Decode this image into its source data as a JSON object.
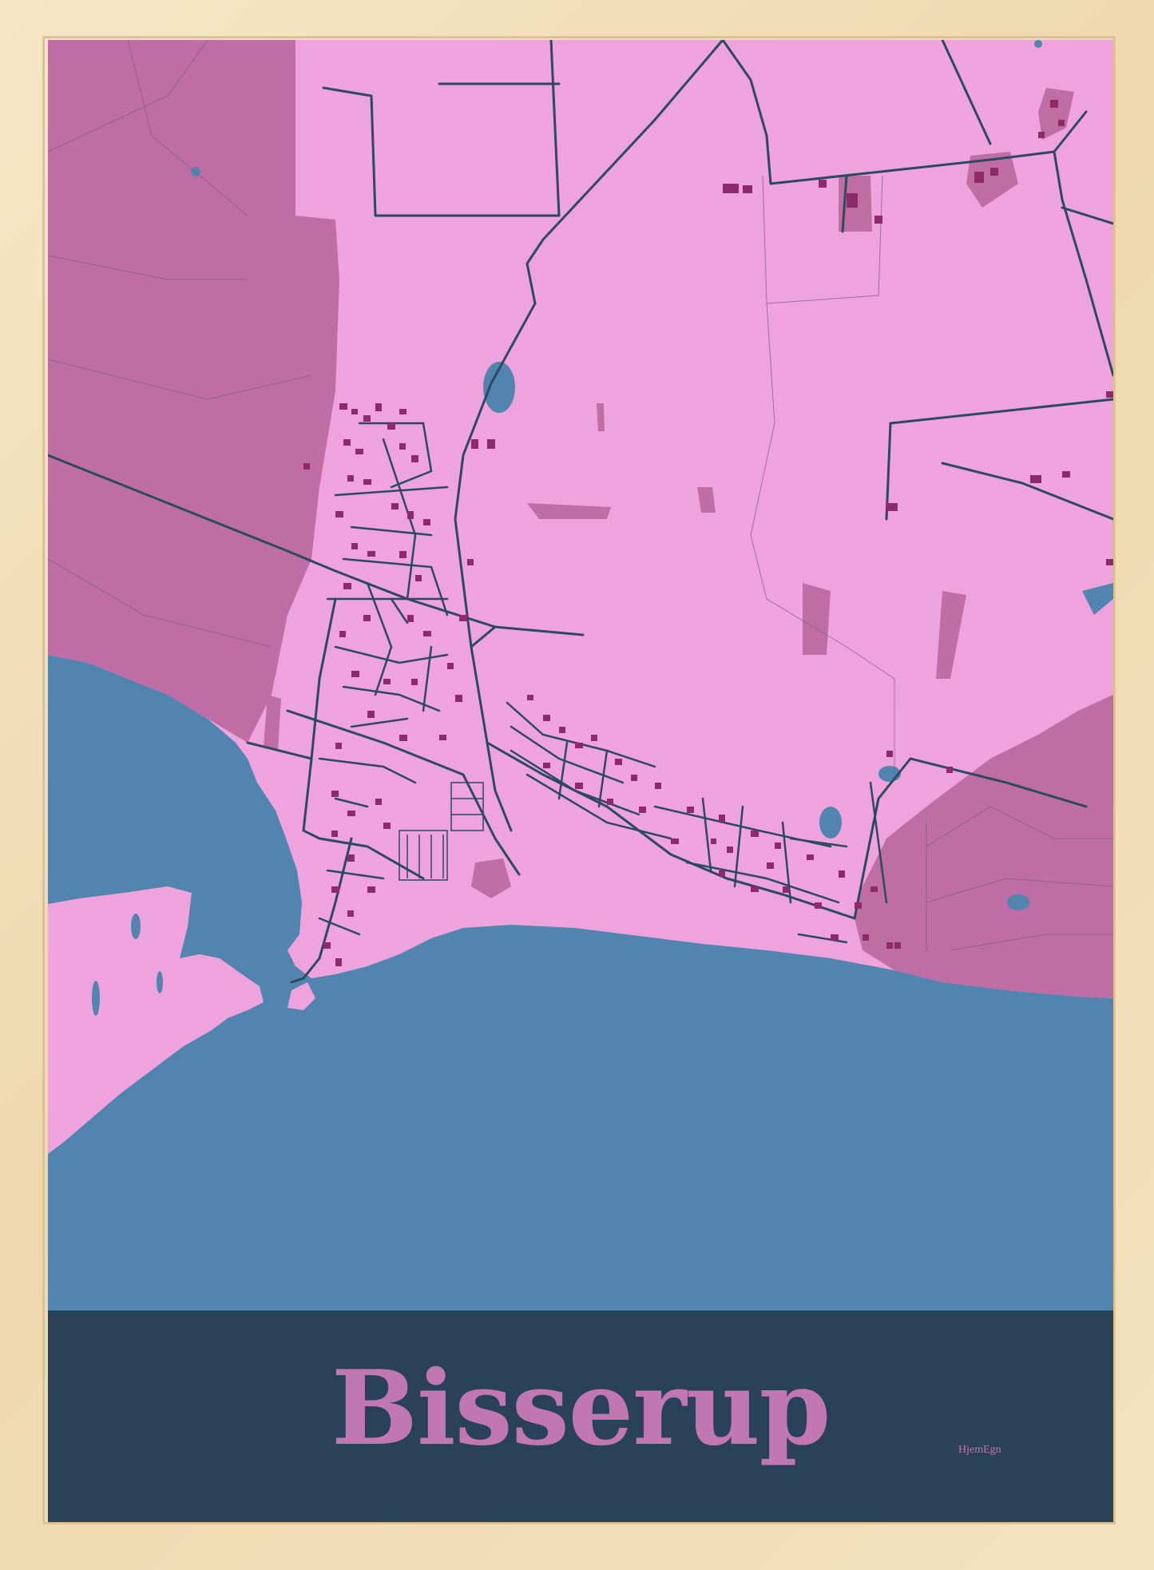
{
  "poster": {
    "city_name": "Bisserup",
    "brand": "HjemEgn"
  },
  "colors": {
    "frame": "#f3dfb8",
    "land": "#efa3dc",
    "dark_land": "#bf6ea5",
    "water": "#5284b0",
    "roads": "#2b4a5e",
    "buildings": "#8c2a6a",
    "banner": "#2a4257",
    "title_text": "#c178b0"
  }
}
